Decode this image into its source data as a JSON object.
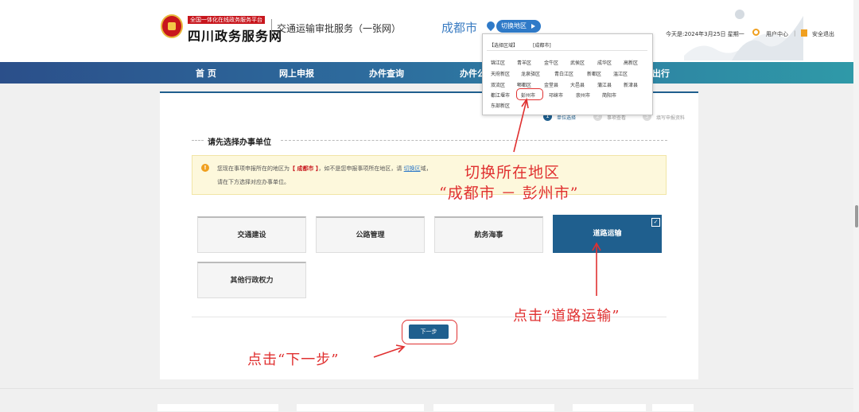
{
  "header": {
    "badge": "全国一体化在线政务服务平台",
    "site_name": "四川政务服务网",
    "subtitle": "交通运输审批服务（一张网）",
    "city": "成都市",
    "switch_region": "切换地区",
    "date": "今天是:2024年3月25日 星期一",
    "user_center": "用户中心",
    "separator": "|",
    "logout": "安全退出"
  },
  "nav": {
    "items": [
      "首 页",
      "网上申报",
      "办件查询",
      "办件公",
      "出行"
    ]
  },
  "region_popup": {
    "tab_select": "【选择区域】",
    "tab_current": "[成都市]",
    "areas": [
      [
        "锦江区",
        "青羊区",
        "金牛区",
        "武侯区",
        "成华区",
        "高新区"
      ],
      [
        "天府新区",
        "龙泉驿区",
        "青白江区",
        "新都区",
        "温江区"
      ],
      [
        "双流区",
        "郫都区",
        "金堂县",
        "大邑县",
        "蒲江县",
        "新津县"
      ],
      [
        "都江堰市",
        "彭州市",
        "邛崃市",
        "崇州市",
        "简阳市"
      ],
      [
        "东部新区"
      ]
    ]
  },
  "steps": [
    {
      "num": "1",
      "label": "单位选择"
    },
    {
      "num": "2",
      "label": "事项查看"
    },
    {
      "num": "3",
      "label": "填写申报资料"
    }
  ],
  "section": {
    "title": "请先选择办事单位"
  },
  "notice": {
    "warn_icon": "!",
    "line1_a": "您现在事项申报所在的地区为",
    "line1_city": "【 成都市 】",
    "line1_b": "，如不是您申报事项所在地区，请",
    "line1_link": "切换区",
    "line1_c": "域，",
    "line2": "请在下方选择对应办事单位。"
  },
  "units": [
    {
      "label": "交通建设",
      "selected": false
    },
    {
      "label": "公路管理",
      "selected": false
    },
    {
      "label": "航务海事",
      "selected": false
    },
    {
      "label": "道路运输",
      "selected": true
    },
    {
      "label": "其他行政权力",
      "selected": false
    }
  ],
  "check_mark": "✓",
  "next_button": "下一步",
  "annotations": {
    "switch_line1": "切换所在地区",
    "switch_line2": "“成都市 － 彭州市”",
    "click_road": "点击“道路运输”",
    "click_next": "点击“下一步”"
  },
  "colors": {
    "primary": "#1f5f8e",
    "annotation": "#e03030",
    "accent": "#2f7ac8",
    "warning": "#f0a020"
  }
}
